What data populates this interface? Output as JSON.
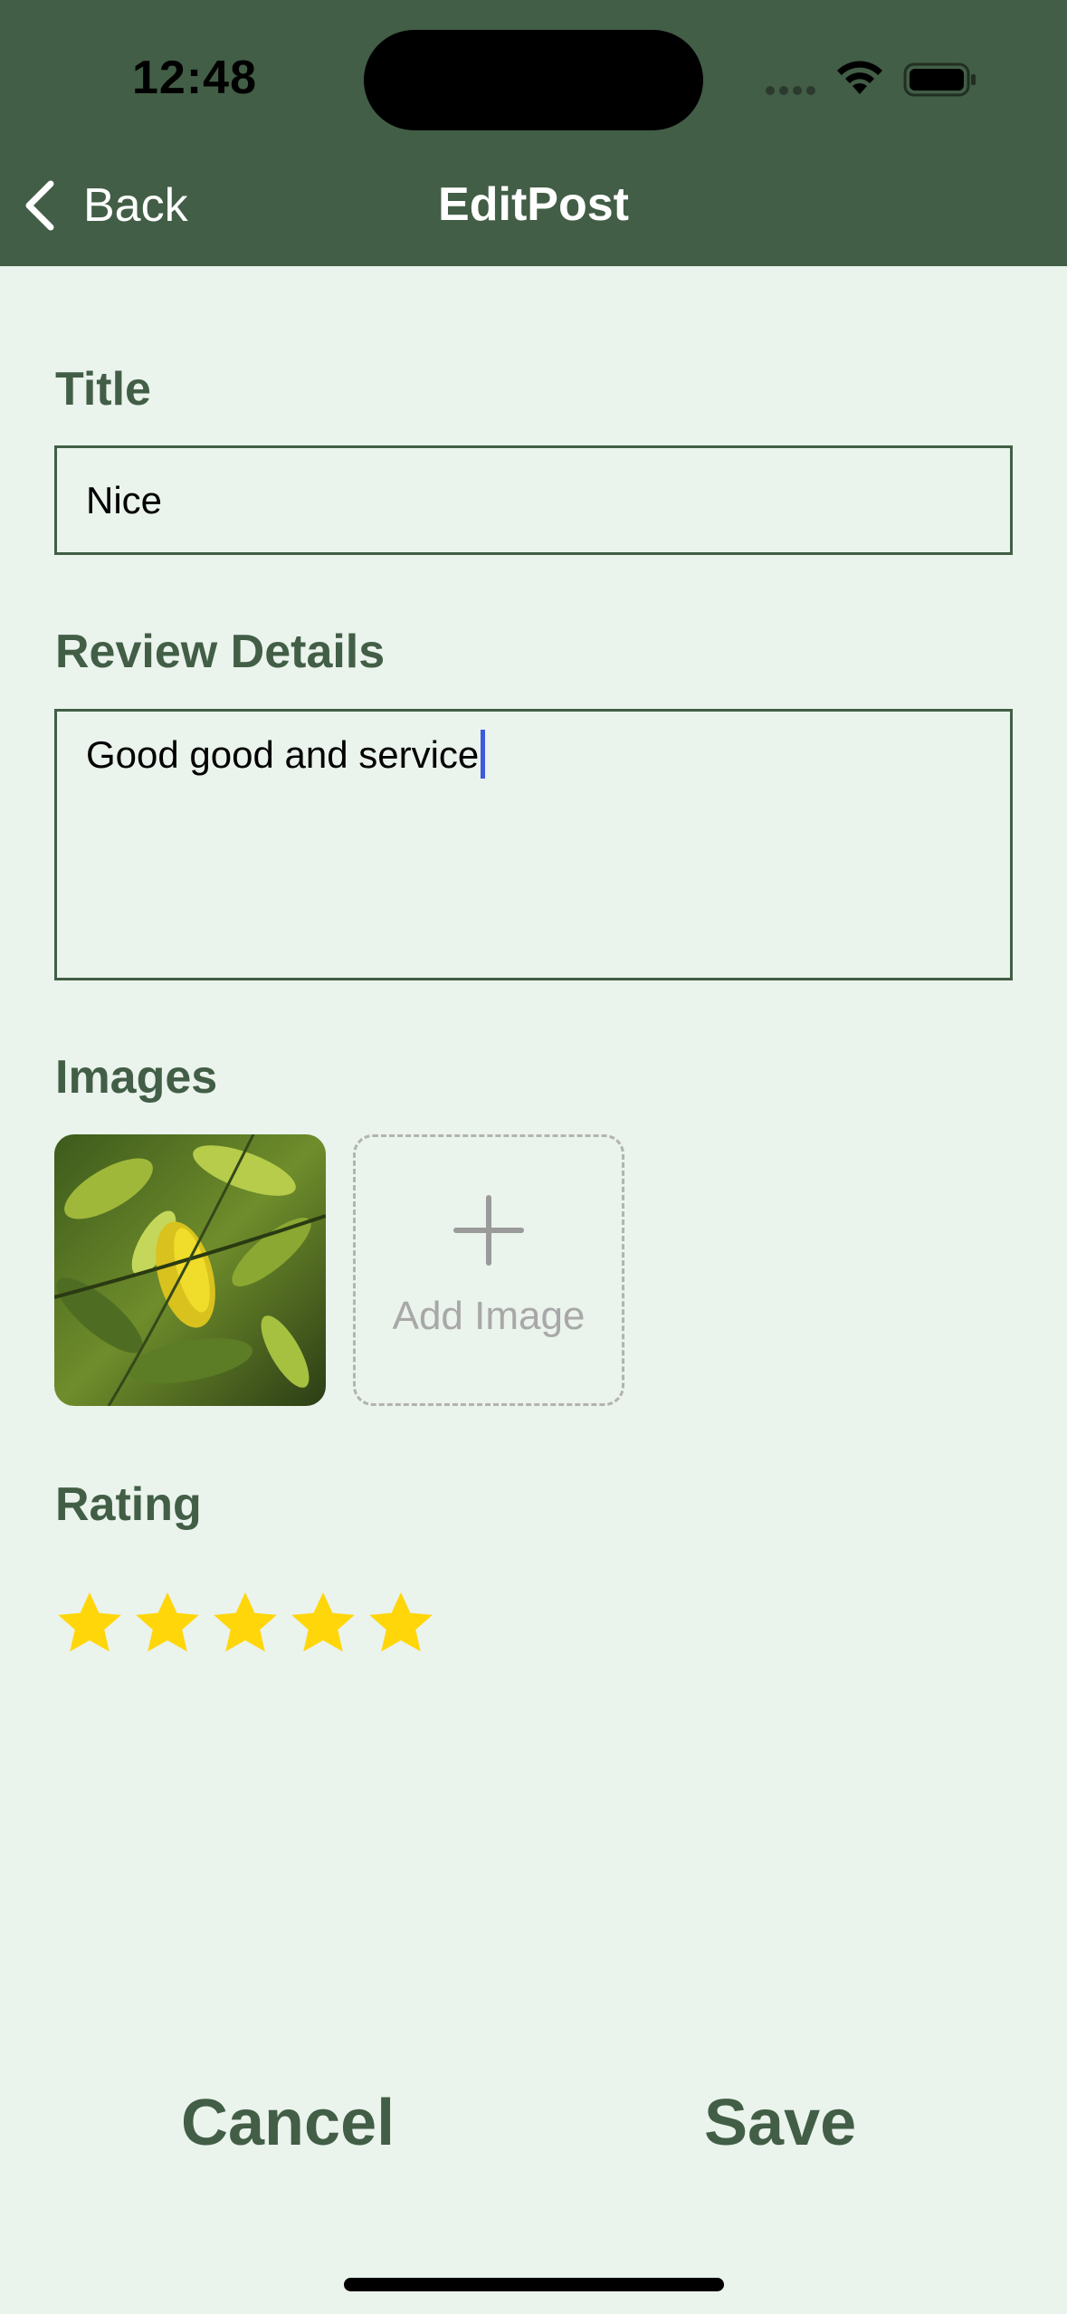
{
  "status_bar": {
    "time": "12:48",
    "icons": [
      "cellular-dots-icon",
      "wifi-icon",
      "battery-icon"
    ]
  },
  "nav": {
    "back_label": "Back",
    "title": "EditPost"
  },
  "form": {
    "title_label": "Title",
    "title_value": "Nice",
    "details_label": "Review Details",
    "details_value": "Good good and service",
    "images_label": "Images",
    "add_image_label": "Add Image",
    "rating_label": "Rating",
    "rating_value": 5,
    "rating_max": 5
  },
  "actions": {
    "cancel_label": "Cancel",
    "save_label": "Save"
  },
  "colors": {
    "header": "#425e46",
    "background": "#eaf3ec",
    "accent": "#425e46",
    "star": "#ffd60a",
    "caret": "#3b5bdb"
  }
}
